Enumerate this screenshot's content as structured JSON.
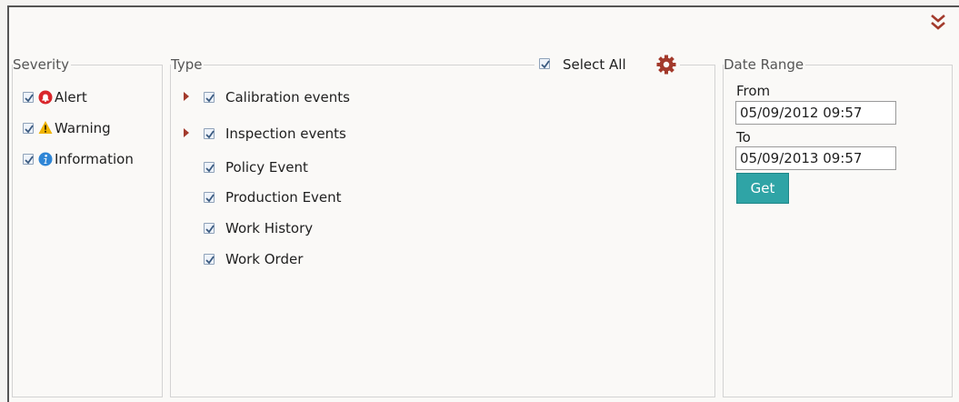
{
  "severity": {
    "legend": "Severity",
    "items": [
      {
        "label": "Alert",
        "checked": true,
        "icon": "alert-icon",
        "color": "#d9262b"
      },
      {
        "label": "Warning",
        "checked": true,
        "icon": "warning-icon",
        "color": "#f0b400"
      },
      {
        "label": "Information",
        "checked": true,
        "icon": "info-icon",
        "color": "#2f86d6"
      }
    ]
  },
  "type": {
    "legend": "Type",
    "select_all_label": "Select All",
    "select_all_checked": true,
    "items": [
      {
        "label": "Calibration events",
        "checked": true,
        "expandable": true
      },
      {
        "label": "Inspection events",
        "checked": true,
        "expandable": true
      },
      {
        "label": "Policy Event",
        "checked": true,
        "expandable": false
      },
      {
        "label": "Production Event",
        "checked": true,
        "expandable": false
      },
      {
        "label": "Work History",
        "checked": true,
        "expandable": false
      },
      {
        "label": "Work Order",
        "checked": true,
        "expandable": false
      }
    ]
  },
  "date_range": {
    "legend": "Date Range",
    "from_label": "From",
    "from_value": "05/09/2012 09:57",
    "to_label": "To",
    "to_value": "05/09/2013 09:57",
    "get_label": "Get"
  },
  "colors": {
    "accent": "#2fa4a6",
    "brand_red": "#a33a2c",
    "checkbox_check": "#3a5a80"
  }
}
